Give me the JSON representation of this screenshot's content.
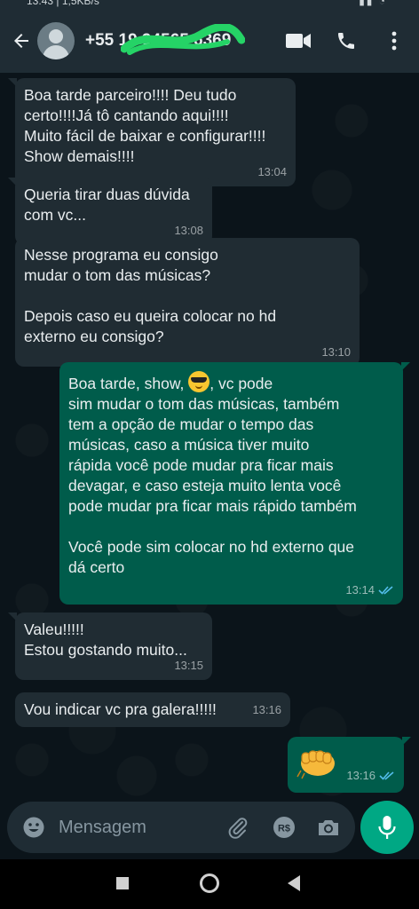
{
  "status_bar": {
    "left_text": "13:43 | 1,5KB/s",
    "right_text": "▮▮ ◔"
  },
  "header": {
    "contact_name": "+55 19 94565 6369",
    "back_icon": "arrow-left-icon",
    "video_icon": "video-call-icon",
    "call_icon": "phone-icon",
    "menu_icon": "more-vert-icon"
  },
  "messages": [
    {
      "dir": "in",
      "text": "Boa tarde parceiro!!!! Deu tudo\ncerto!!!!Já tô cantando aqui!!!!\nMuito fácil de baixar e configurar!!!!\nShow demais!!!!",
      "time": "13:04"
    },
    {
      "dir": "in",
      "text": "Queria tirar duas dúvida\ncom vc...",
      "time": "13:08"
    },
    {
      "dir": "in",
      "text": "Nesse programa eu consigo\nmudar o tom das músicas?\n\nDepois caso eu queira colocar no hd\nexterno eu consigo?",
      "time": "13:10"
    },
    {
      "dir": "out",
      "text_before_emoji": "Boa tarde, show, ",
      "emoji": "smiling-face-with-sunglasses",
      "text_after_emoji": ", vc pode\nsim mudar o tom das músicas, também\ntem a opção de mudar o tempo das\nmúsicas, caso a música tiver muito\nrápida você pode mudar pra ficar mais\ndevagar, e caso esteja muito lenta você\npode mudar pra ficar mais rápido também\n\nVocê pode sim colocar no hd externo que\ndá certo",
      "time": "13:14",
      "status": "read"
    },
    {
      "dir": "in",
      "text": "Valeu!!!!!\nEstou gostando muito...",
      "time": "13:15"
    },
    {
      "dir": "in",
      "text": "Vou indicar vc pra galera!!!!!",
      "time": "13:16"
    },
    {
      "dir": "out",
      "emoji": "oncoming-fist",
      "time": "13:16",
      "status": "read"
    }
  ],
  "composer": {
    "placeholder": "Mensagem",
    "emoji_icon": "emoji-icon",
    "attach_icon": "paperclip-icon",
    "payment_icon": "payment-rs-icon",
    "payment_label": "R$",
    "camera_icon": "camera-icon",
    "mic_icon": "mic-icon"
  },
  "colors": {
    "header_bg": "#1f2c34",
    "incoming_bubble": "#202c33",
    "outgoing_bubble": "#005c4b",
    "accent": "#00a884",
    "read_ticks": "#53bdeb",
    "scribble": "#25d366"
  }
}
